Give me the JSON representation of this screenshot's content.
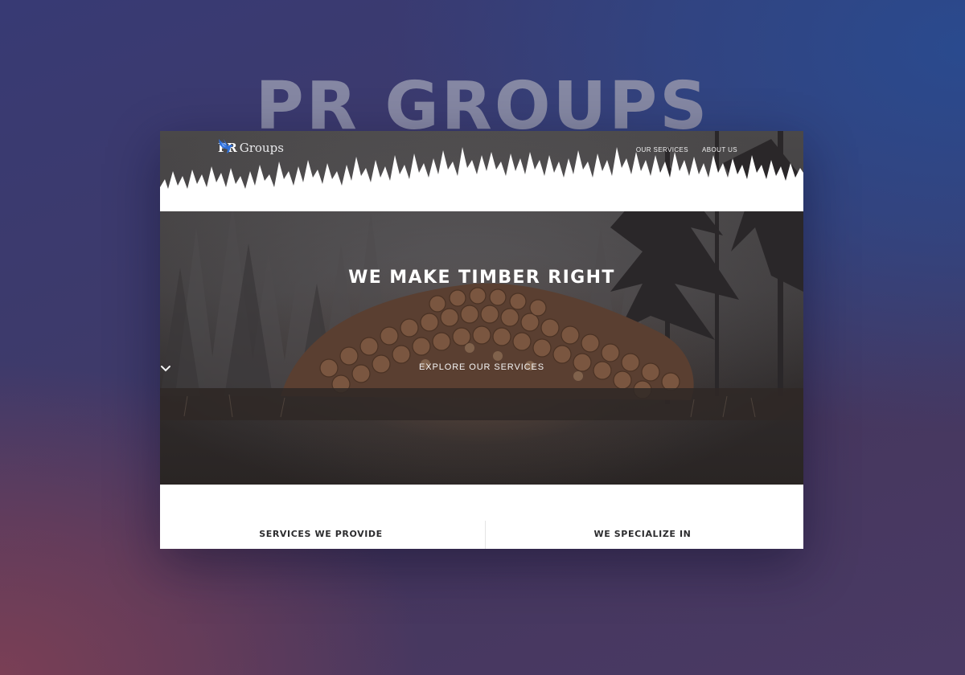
{
  "backdrop": {
    "title": "PR GROUPS"
  },
  "site": {
    "logo": {
      "strong": "PR",
      "light": "Groups",
      "icon": "bird-icon"
    },
    "nav": [
      {
        "label": "OUR SERVICES"
      },
      {
        "label": "ABOUT US"
      }
    ],
    "hero": {
      "title": "WE MAKE TIMBER RIGHT",
      "cta_label": "EXPLORE OUR SERVICES",
      "cta_icon": "chevron-down-icon"
    },
    "sections": [
      {
        "label": "SERVICES WE PROVIDE"
      },
      {
        "label": "WE SPECIALIZE IN"
      }
    ]
  },
  "colors": {
    "accent_blue": "#2f6fd6",
    "hero_dark": "#2e2a2a",
    "text_dark": "#2c2c2e"
  }
}
